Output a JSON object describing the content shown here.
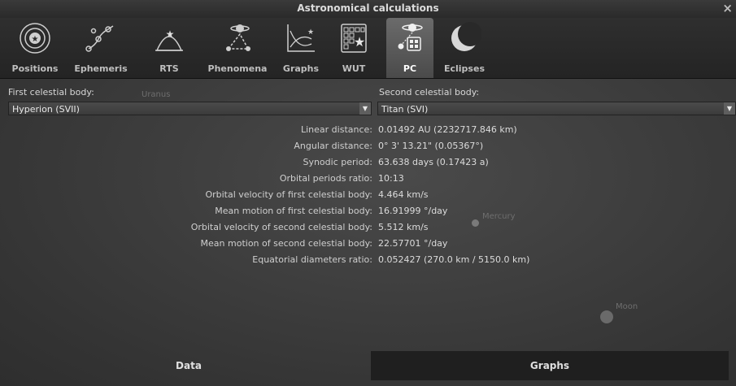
{
  "window": {
    "title": "Astronomical calculations",
    "close_glyph": "×"
  },
  "tabs": [
    {
      "label": "Positions",
      "icon": "positions-icon"
    },
    {
      "label": "Ephemeris",
      "icon": "ephemeris-icon"
    },
    {
      "label": "RTS",
      "icon": "rts-icon"
    },
    {
      "label": "Phenomena",
      "icon": "phenomena-icon"
    },
    {
      "label": "Graphs",
      "icon": "graphs-icon"
    },
    {
      "label": "WUT",
      "icon": "wut-icon"
    },
    {
      "label": "PC",
      "icon": "pc-icon",
      "active": true
    },
    {
      "label": "Eclipses",
      "icon": "eclipses-icon"
    }
  ],
  "first_body": {
    "label": "First celestial body:",
    "value": "Hyperion (SVII)"
  },
  "second_body": {
    "label": "Second celestial body:",
    "value": "Titan (SVI)"
  },
  "results": [
    {
      "key": "Linear distance:",
      "value": "0.01492 AU (2232717.846 km)"
    },
    {
      "key": "Angular distance:",
      "value": "0° 3' 13.21\" (0.05367°)"
    },
    {
      "key": "Synodic period:",
      "value": "63.638 days (0.17423 a)"
    },
    {
      "key": "Orbital periods ratio:",
      "value": "10:13"
    },
    {
      "key": "Orbital velocity of first celestial body:",
      "value": "4.464 km/s"
    },
    {
      "key": "Mean motion of first celestial body:",
      "value": "16.91999 °/day"
    },
    {
      "key": "Orbital velocity of second celestial body:",
      "value": "5.512 km/s"
    },
    {
      "key": "Mean motion of second celestial body:",
      "value": "22.57701 °/day"
    },
    {
      "key": "Equatorial diameters ratio:",
      "value": "0.052427 (270.0 km / 5150.0 km)"
    }
  ],
  "bottom_tabs": {
    "data": "Data",
    "graphs": "Graphs"
  },
  "sky_labels": {
    "uranus": "Uranus",
    "mercury": "Mercury",
    "moon": "Moon"
  }
}
